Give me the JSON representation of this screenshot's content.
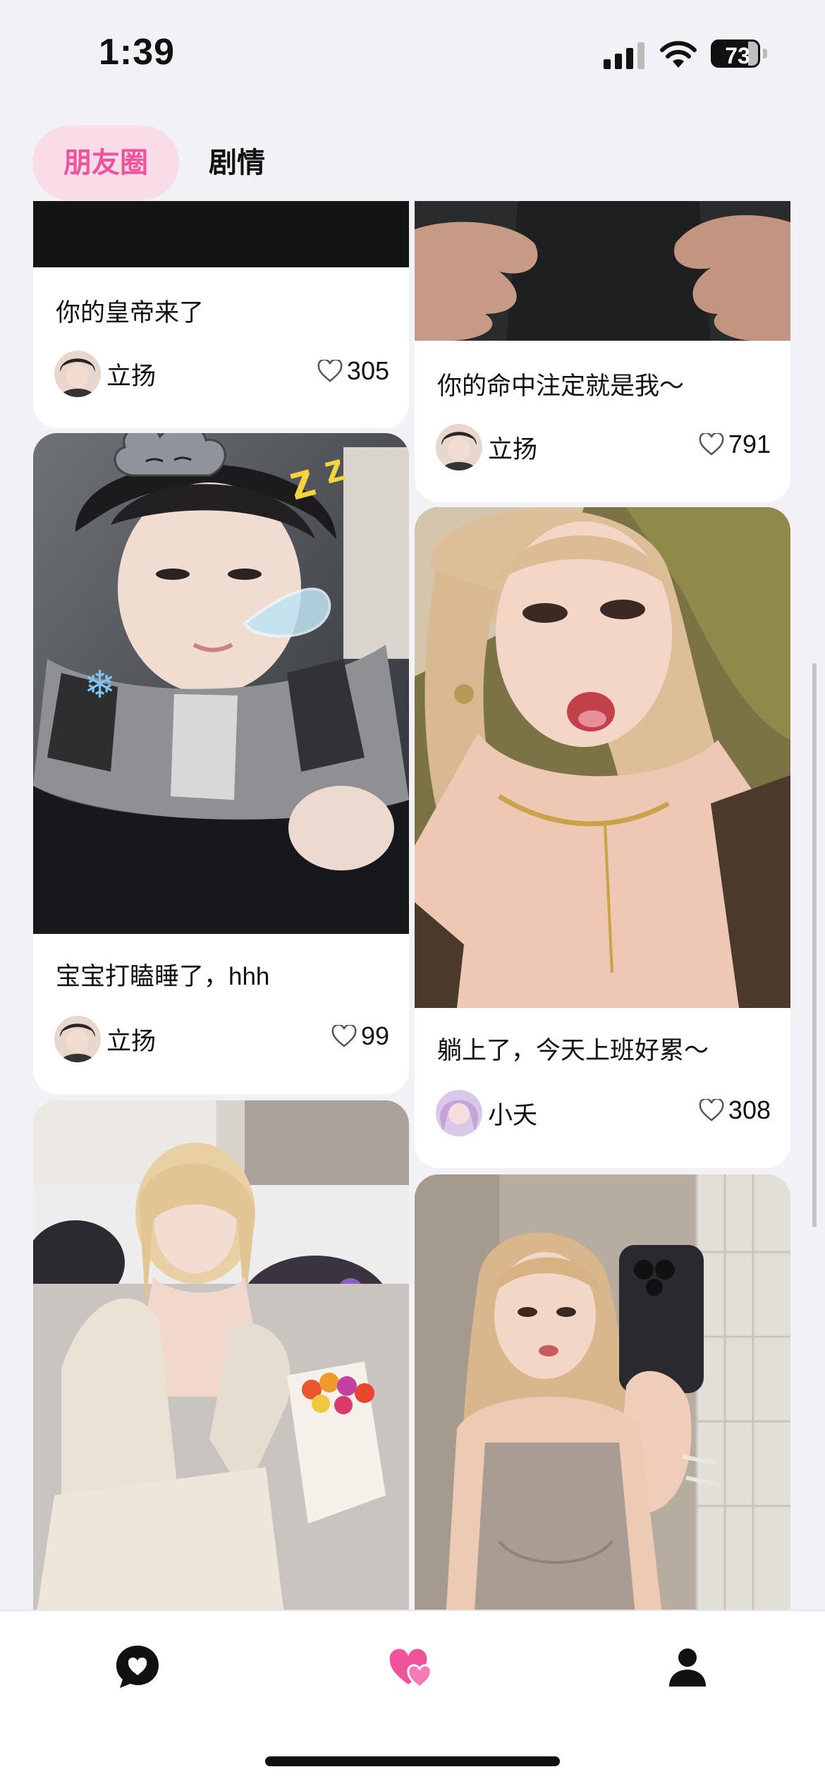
{
  "status_bar": {
    "time": "1:39",
    "battery": "73"
  },
  "tabs": [
    {
      "label": "朋友圈",
      "active": true
    },
    {
      "label": "剧情",
      "active": false
    }
  ],
  "posts": [
    {
      "caption": "你的皇帝来了",
      "author": "立扬",
      "likes": "305"
    },
    {
      "caption": "宝宝打瞌睡了，hhh",
      "author": "立扬",
      "likes": "99"
    },
    {
      "caption": "你的命中注定就是我～",
      "author": "立扬",
      "likes": "791"
    },
    {
      "caption": "躺上了，今天上班好累～",
      "author": "小夭",
      "likes": "308"
    }
  ],
  "bottom_nav": [
    {
      "icon": "chat-heart-icon",
      "active": false
    },
    {
      "icon": "hearts-icon",
      "active": true
    },
    {
      "icon": "profile-icon",
      "active": false
    }
  ],
  "colors": {
    "accent": "#f0529c",
    "tab_active_bg": "#f8dde9",
    "background": "#f1f1f6"
  }
}
